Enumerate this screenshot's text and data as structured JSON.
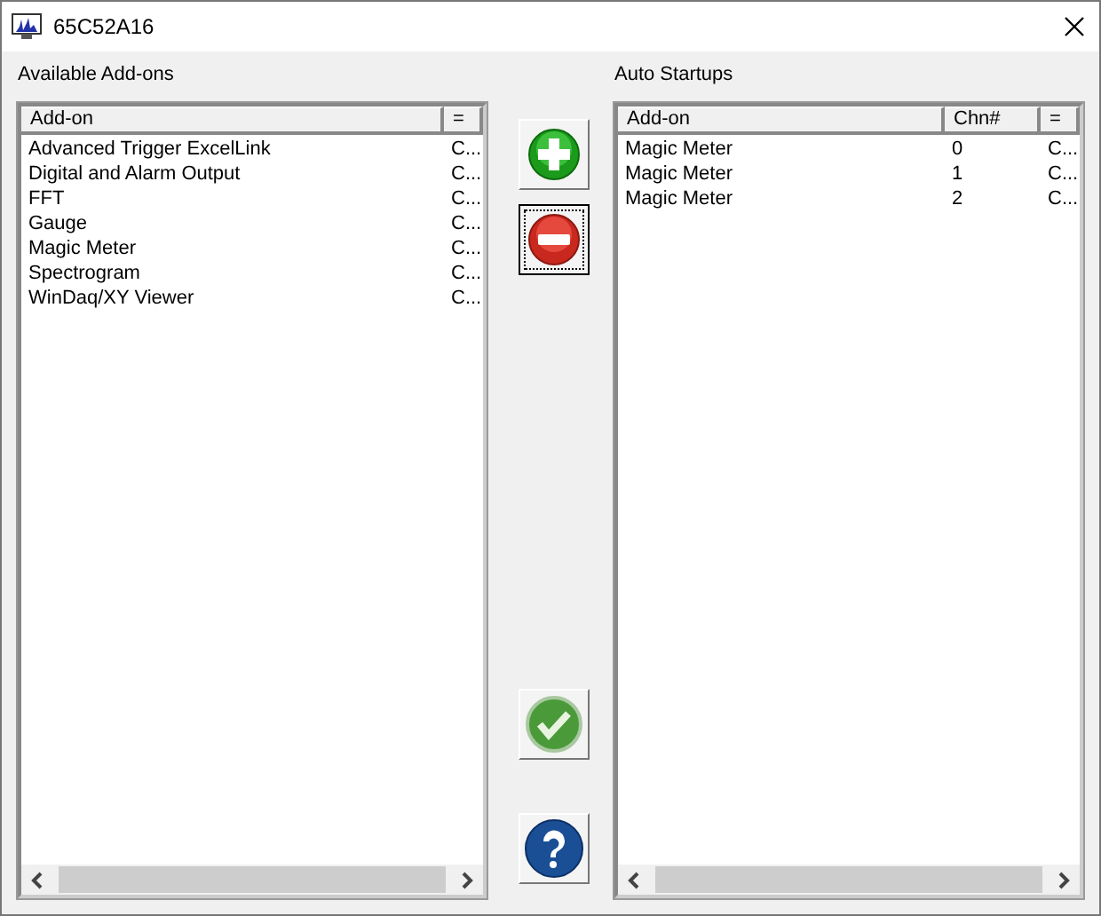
{
  "window": {
    "title": "65C52A16"
  },
  "available": {
    "label": "Available Add-ons",
    "columns": [
      "Add-on",
      "="
    ],
    "rows": [
      [
        "Advanced Trigger ExcelLink",
        "C..."
      ],
      [
        "Digital and Alarm Output",
        "C..."
      ],
      [
        "FFT",
        "C..."
      ],
      [
        "Gauge",
        "C..."
      ],
      [
        "Magic Meter",
        "C..."
      ],
      [
        "Spectrogram",
        "C..."
      ],
      [
        "WinDaq/XY Viewer",
        "C..."
      ]
    ]
  },
  "buttons": [
    {
      "kind": "add",
      "focused": false
    },
    {
      "kind": "remove",
      "focused": true
    },
    {
      "kind": "ok",
      "focused": false
    },
    {
      "kind": "help",
      "focused": false
    }
  ],
  "auto_startups": {
    "label": "Auto Startups",
    "columns": [
      "Add-on",
      "Chn#",
      "="
    ],
    "rows": [
      [
        "Magic Meter",
        "0",
        "C..."
      ],
      [
        "Magic Meter",
        "1",
        "C..."
      ],
      [
        "Magic Meter",
        "2",
        "C..."
      ]
    ]
  }
}
